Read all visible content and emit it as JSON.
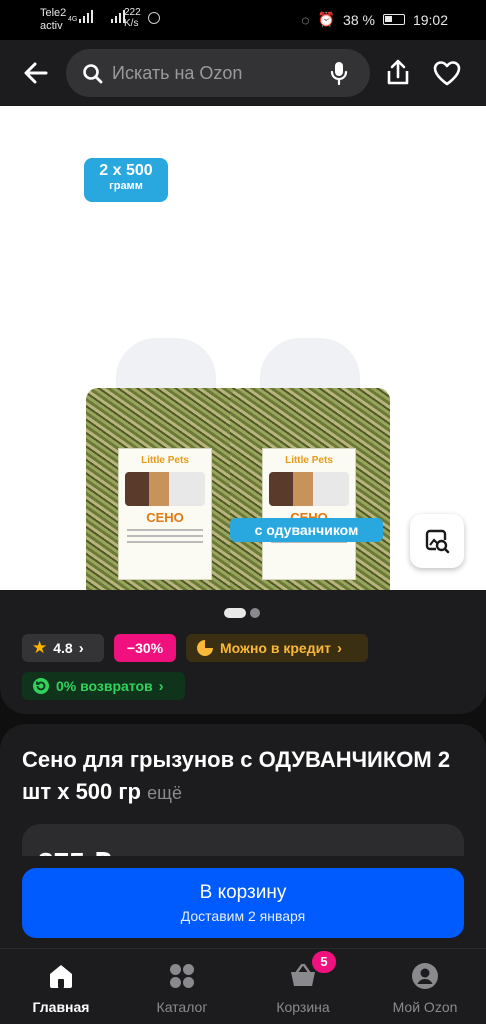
{
  "status_bar": {
    "carrier": "Tele2",
    "carrier_sub": "activ",
    "network": "4G",
    "speed_value": "222",
    "speed_unit": "K/s",
    "battery": "38 %",
    "time": "19:02"
  },
  "header": {
    "search_placeholder": "Искать на Ozon",
    "icons": [
      "arrow-left-icon",
      "search-icon",
      "microphone-icon",
      "share-icon",
      "heart-icon"
    ]
  },
  "gallery": {
    "weight_badge_top": "2 x 500",
    "weight_badge_bottom": "грамм",
    "bag_brand": "Little Pets",
    "bag_product": "СЕНО",
    "variant_badge": "с одуванчиком",
    "page_count": 2,
    "active_page": 1
  },
  "badges": {
    "rating": "4.8",
    "discount": "−30%",
    "credit": "Можно в кредит",
    "returns": "0% возвратов"
  },
  "product": {
    "title": "Сено для грызунов с ОДУВАНЧИКОМ 2 шт х 500 гр",
    "more": "ещё",
    "price_partial": "375 ₽"
  },
  "cart_button": {
    "label": "В корзину",
    "delivery": "Доставим 2 января"
  },
  "bottom_nav": {
    "home": "Главная",
    "catalog": "Каталог",
    "cart": "Корзина",
    "cart_count": "5",
    "profile": "Мой Ozon"
  },
  "colors": {
    "accent": "#005bff",
    "discount": "#f1117e",
    "credit_text": "#fbb838",
    "returns_text": "#31d35c",
    "badge_blue": "#29a8e0"
  }
}
